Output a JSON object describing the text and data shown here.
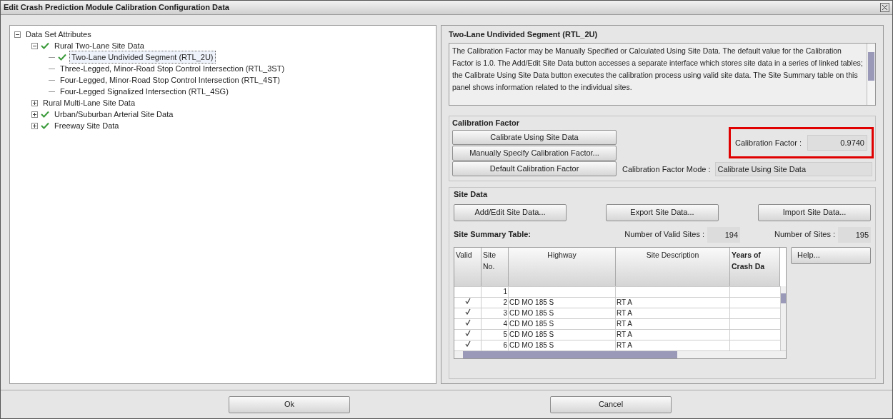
{
  "window": {
    "title": "Edit Crash Prediction Module Calibration Configuration Data"
  },
  "tree": [
    {
      "label": "Data Set Attributes",
      "checked": false,
      "expanded": true,
      "selected": false,
      "children": [
        {
          "label": "Rural Two-Lane Site Data",
          "checked": true,
          "expanded": true,
          "selected": false,
          "children": [
            {
              "label": "Two-Lane Undivided Segment (RTL_2U)",
              "checked": true,
              "selected": true
            },
            {
              "label": "Three-Legged, Minor-Road Stop Control Intersection (RTL_3ST)",
              "checked": false,
              "selected": false
            },
            {
              "label": "Four-Legged, Minor-Road Stop Control Intersection (RTL_4ST)",
              "checked": false,
              "selected": false
            },
            {
              "label": "Four-Legged Signalized Intersection (RTL_4SG)",
              "checked": false,
              "selected": false
            }
          ]
        },
        {
          "label": "Rural Multi-Lane Site Data",
          "checked": false,
          "expanded": false,
          "selected": false
        },
        {
          "label": "Urban/Suburban Arterial Site Data",
          "checked": true,
          "expanded": false,
          "selected": false
        },
        {
          "label": "Freeway Site Data",
          "checked": true,
          "expanded": false,
          "selected": false
        }
      ]
    }
  ],
  "detail": {
    "title": "Two-Lane Undivided Segment (RTL_2U)",
    "description": "The Calibration Factor may be Manually Specified or Calculated Using Site Data. The default value for the Calibration Factor is 1.0. The Add/Edit Site Data button accesses a separate interface which stores site data in a series of linked tables; the Calibrate Using Site Data button executes the calibration process using valid site data. The Site Summary table on this panel shows information related to the individual sites.",
    "calibration": {
      "title": "Calibration Factor",
      "buttons": [
        "Calibrate Using Site Data",
        "Manually Specify Calibration Factor...",
        "Default Calibration Factor"
      ],
      "factor_label": "Calibration Factor :",
      "factor_value": "0.9740",
      "factor_highlighted": true,
      "mode_label": "Calibration Factor Mode :",
      "mode_value": "Calibrate Using Site Data"
    },
    "site_data": {
      "title": "Site Data",
      "buttons": [
        "Add/Edit Site Data...",
        "Export Site Data...",
        "Import Site Data..."
      ],
      "summary_label": "Site Summary Table:",
      "valid_label": "Number of Valid Sites :",
      "valid_value": "194",
      "sites_label": "Number of Sites :",
      "sites_value": "195",
      "help_button": "Help...",
      "table": {
        "columns": [
          "Valid",
          "Site No.",
          "Highway",
          "Site Description",
          "Years of Crash Da"
        ],
        "rows": [
          {
            "valid": false,
            "site_no": "1"
          },
          {
            "valid": true,
            "site_no": "2",
            "highway": "CD MO 185 S",
            "description": "RT A"
          },
          {
            "valid": true,
            "site_no": "3",
            "highway": "CD MO 185 S",
            "description": "RT A"
          },
          {
            "valid": true,
            "site_no": "4",
            "highway": "CD MO 185 S",
            "description": "RT A"
          },
          {
            "valid": true,
            "site_no": "5",
            "highway": "CD MO 185 S",
            "description": "RT A"
          },
          {
            "valid": true,
            "site_no": "6",
            "highway": "CD MO 185 S",
            "description": "RT A"
          }
        ]
      }
    }
  },
  "footer": {
    "ok": "Ok",
    "cancel": "Cancel"
  }
}
